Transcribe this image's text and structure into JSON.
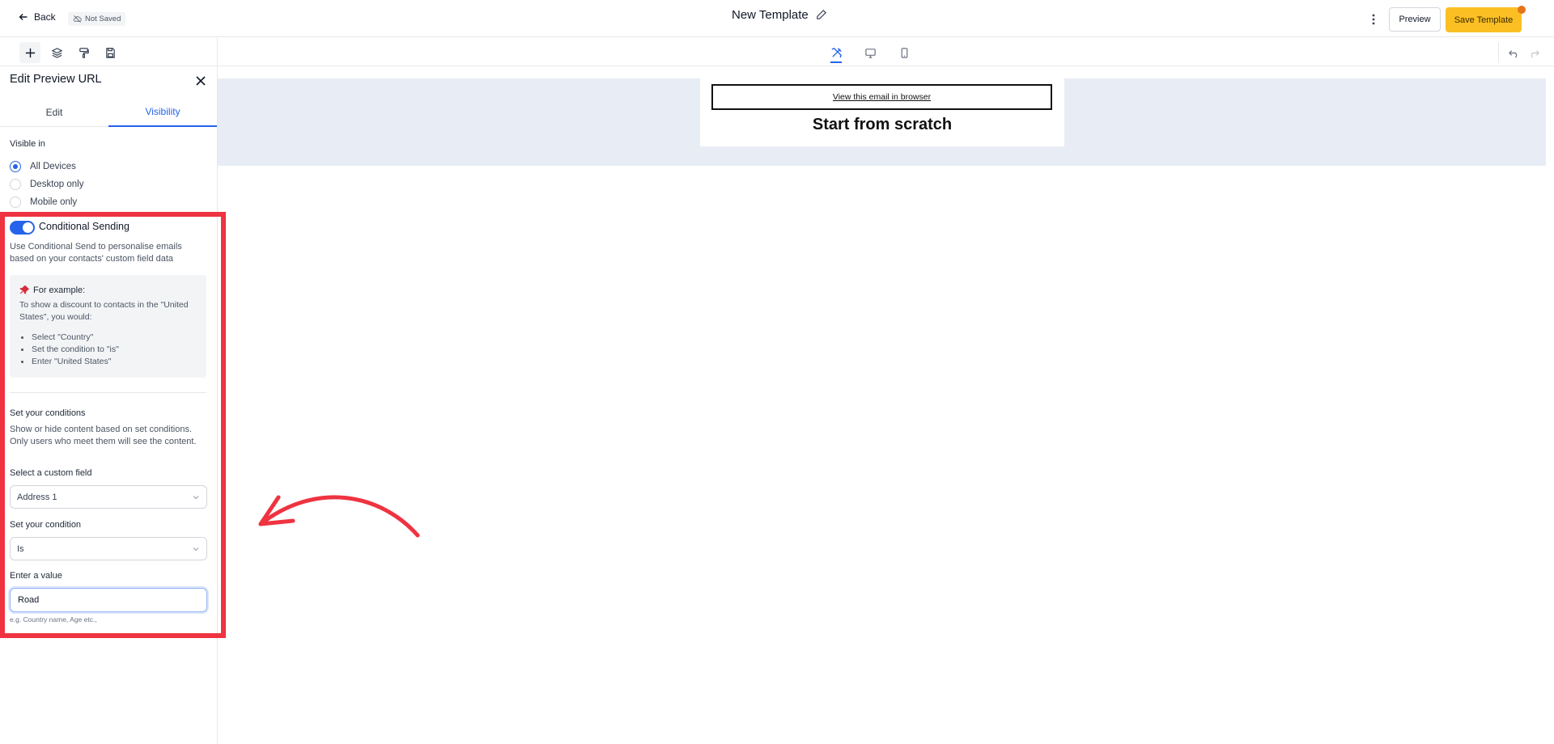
{
  "header": {
    "back_label": "Back",
    "status_badge": "Not Saved",
    "title": "New Template",
    "preview_label": "Preview",
    "save_label": "Save Template"
  },
  "toolbar": {
    "left_tools": [
      "add-icon",
      "layers-icon",
      "paint-roller-icon",
      "save-icon"
    ],
    "view_modes": [
      "design-tools-icon",
      "desktop-icon",
      "mobile-icon"
    ],
    "history": [
      "undo-icon",
      "redo-icon"
    ]
  },
  "panel": {
    "title": "Edit Preview URL",
    "tabs": [
      "Edit",
      "Visibility"
    ],
    "active_tab": "Visibility",
    "visible_in_label": "Visible in",
    "visibility_options": [
      "All Devices",
      "Desktop only",
      "Mobile only"
    ],
    "selected_visibility": "All Devices",
    "conditional_label": "Conditional Sending",
    "conditional_enabled": true,
    "conditional_desc": "Use Conditional Send to personalise emails based on your contacts' custom field data",
    "example_head": "For example:",
    "example_body": "To show a discount to contacts in the \"United States\", you would:",
    "example_steps": [
      "Select \"Country\"",
      "Set the condition to \"is\"",
      "Enter \"United States\""
    ],
    "conditions_label": "Set your conditions",
    "conditions_desc": "Show or hide content based on set conditions. Only users who meet them will see the content.",
    "field_label": "Select a custom field",
    "field_value": "Address 1",
    "condition_label": "Set your condition",
    "condition_value": "Is",
    "value_label": "Enter a value",
    "value_input": "Road",
    "value_hint": "e.g. Country name, Age etc.,"
  },
  "canvas": {
    "view_browser_link": "View this email in browser",
    "heading": "Start from scratch"
  },
  "colors": {
    "accent": "#2563eb",
    "save_button": "#fbbf24",
    "annotation": "#ef3340",
    "canvas_band": "#e8edf5"
  }
}
